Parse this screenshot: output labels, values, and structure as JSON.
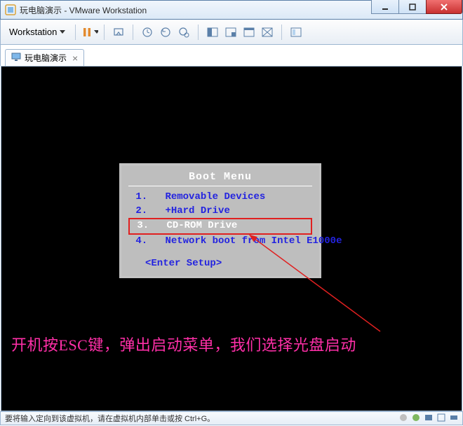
{
  "window": {
    "title": "玩电脑演示 - VMware Workstation"
  },
  "menubar": {
    "workstation_label": "Workstation"
  },
  "tabs": [
    {
      "label": "玩电脑演示"
    }
  ],
  "bios": {
    "title": "Boot Menu",
    "items": [
      {
        "num": "1.",
        "label": "Removable Devices",
        "selected": false
      },
      {
        "num": "2.",
        "label": "+Hard Drive",
        "selected": false
      },
      {
        "num": "3.",
        "label": "CD-ROM Drive",
        "selected": true
      },
      {
        "num": "4.",
        "label": "Network boot from Intel E1000e",
        "selected": false
      }
    ],
    "setup_label": "<Enter Setup>"
  },
  "annotation": {
    "text": "开机按ESC键，弹出启动菜单，我们选择光盘启动"
  },
  "statusbar": {
    "hint": "要将输入定向到该虚拟机，请在虚拟机内部单击或按 Ctrl+G。"
  },
  "icons": {
    "app": "app-icon",
    "minimize": "minimize-icon",
    "maximize": "maximize-icon",
    "close": "close-icon",
    "dropdown": "chevron-down-icon",
    "pause": "pause-icon",
    "tab": "monitor-icon",
    "tab_close": "close-icon"
  },
  "colors": {
    "accent": "#4a90d9",
    "bios_blue": "#2323e0",
    "bios_bg": "#bebebe",
    "highlight_border": "#e02020",
    "annotation": "#ff2fa8"
  }
}
